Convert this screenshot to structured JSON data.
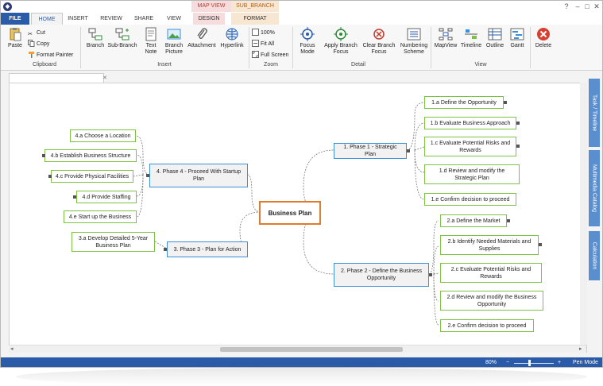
{
  "titlebar": {
    "app_icon": "app-logo-icon",
    "context_heads": [
      "MAP VIEW",
      "SUB_BRANCH"
    ],
    "window_buttons": [
      "?",
      "–",
      "□",
      "✕"
    ]
  },
  "tabs": [
    "FILE",
    "HOME",
    "INSERT",
    "REVIEW",
    "SHARE",
    "VIEW",
    "DESIGN",
    "FORMAT"
  ],
  "ribbon": {
    "clipboard": {
      "paste": "Paste",
      "cut": "Cut",
      "copy": "Copy",
      "format_painter": "Format Painter",
      "group": "Clipboard"
    },
    "insert": {
      "branch": "Branch",
      "sub_branch": "Sub-Branch",
      "text_note": "Text Note",
      "branch_picture": "Branch Picture",
      "attachment": "Attachment",
      "hyperlink": "Hyperlink",
      "group": "Insert"
    },
    "zoom": {
      "z100": "100%",
      "fit_all": "Fit All",
      "full_screen": "Full Screen",
      "group": "Zoom"
    },
    "detail": {
      "focus_mode": "Focus Mode",
      "apply_focus": "Apply Branch Focus",
      "clear_focus": "Clear Branch Focus",
      "numbering": "Numbering Scheme",
      "group": "Detail"
    },
    "view": {
      "mapview": "MapView",
      "timeline": "Timeline",
      "outline": "Outline",
      "gantt": "Gantt",
      "group": "View"
    },
    "delete": "Delete"
  },
  "doc_tab": {
    "close": "✕"
  },
  "map": {
    "central": "Business Plan",
    "phase1": {
      "title": "1.  Phase 1 - Strategic Plan",
      "items": [
        "1.a   Define the Opportunity",
        "1.b   Evaluate Business Approach",
        "1.c   Evaluate Potential Risks and Rewards",
        "1.d   Review and modify the Strategic Plan",
        "1.e   Confirm decision to proceed"
      ]
    },
    "phase2": {
      "title": "2.   Phase 2 - Define the Business Opportunity",
      "items": [
        "2.a   Define the Market",
        "2.b   Identify Needed Materials and Supplies",
        "2.c   Evaluate Potential Risks and Rewards",
        "2.d   Review and modify the Business Opportunity",
        "2.e   Confirm decision to proceed"
      ]
    },
    "phase3": {
      "title": "3.  Phase 3 - Plan for Action",
      "items": [
        "3.a   Develop Detailed 5-Year Business Plan"
      ]
    },
    "phase4": {
      "title": "4.   Phase 4 - Proceed With Startup Plan",
      "items": [
        "4.a   Choose a Location",
        "4.b   Establish Business Structure",
        "4.c   Provide Physical Facilities",
        "4.d   Provide Staffing",
        "4.e   Start up the Business"
      ]
    }
  },
  "side_tabs": [
    "Task / Timeline",
    "Multimedia Catalog",
    "Calculation"
  ],
  "status": {
    "zoom": "80%",
    "minus": "−",
    "plus": "+",
    "pen_mode": "Pen Mode"
  }
}
